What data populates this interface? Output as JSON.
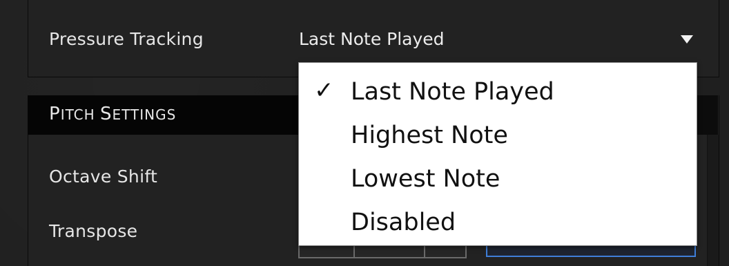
{
  "pressure_tracking": {
    "label": "Pressure Tracking",
    "selected_value": "Last Note Played",
    "options": [
      {
        "label": "Last Note Played",
        "checked": true
      },
      {
        "label": "Highest Note",
        "checked": false
      },
      {
        "label": "Lowest Note",
        "checked": false
      },
      {
        "label": "Disabled",
        "checked": false
      }
    ]
  },
  "pitch_settings": {
    "title_first": "P",
    "title_rest_1": "ITCH ",
    "title_second": "S",
    "title_rest_2": "ETTINGS",
    "rows": [
      {
        "label": "Octave Shift"
      },
      {
        "label": "Transpose"
      }
    ]
  },
  "icons": {
    "dropdown_arrow": "caret-down-icon",
    "check": "checkmark-icon"
  },
  "colors": {
    "background": "#1f1f1f",
    "section_header": "#050505",
    "menu_background": "#ffffff",
    "accent_blue": "#3f7fd9"
  }
}
